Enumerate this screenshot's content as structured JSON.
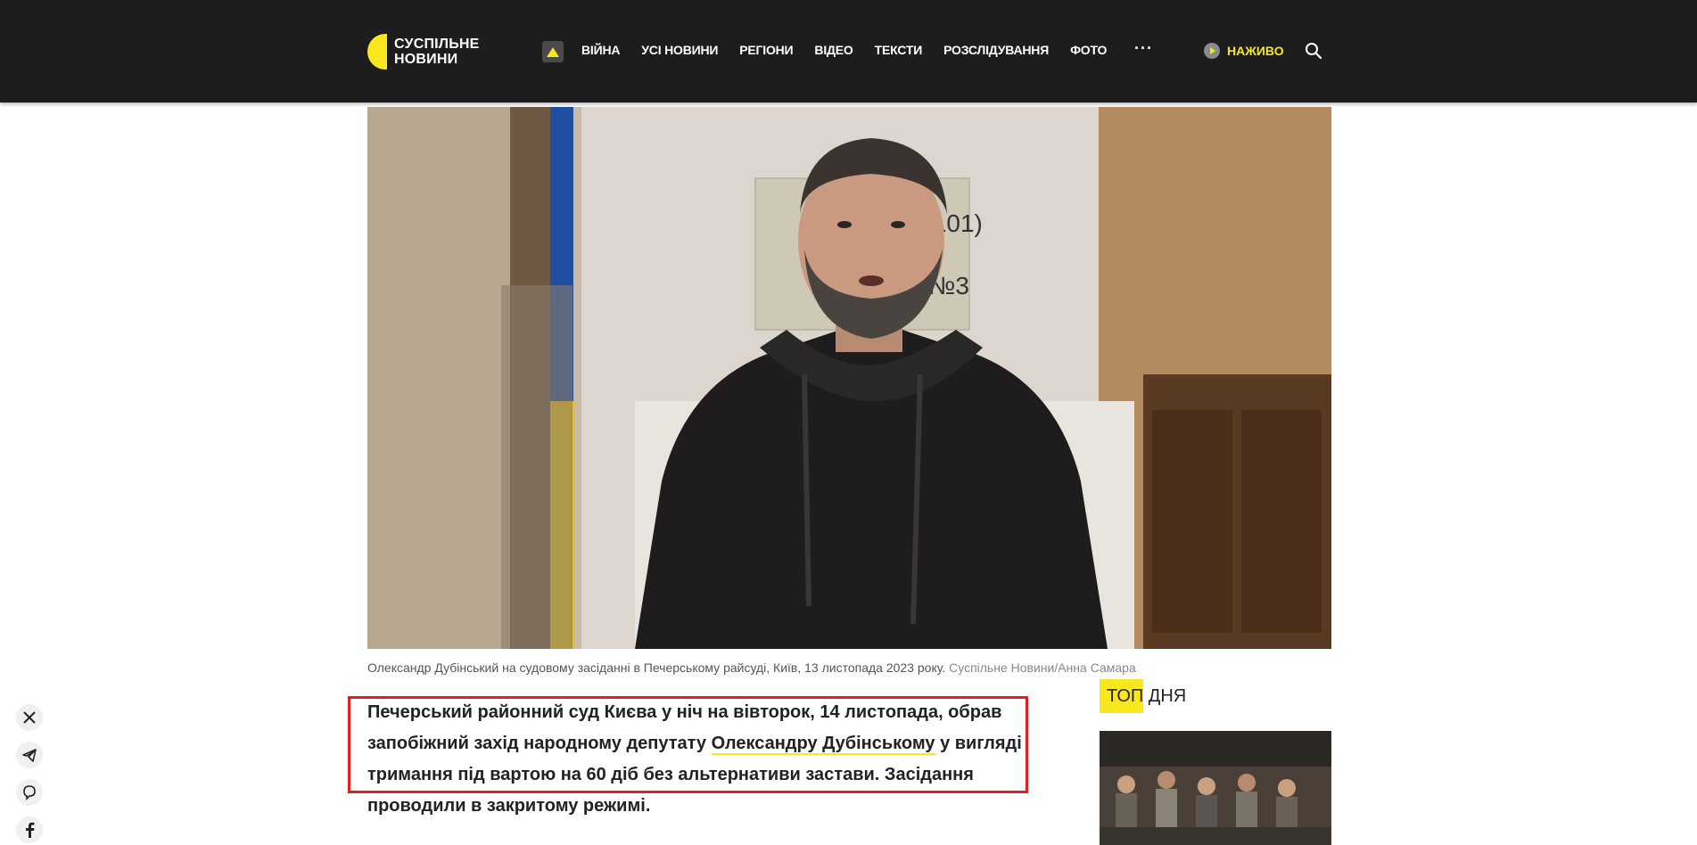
{
  "header": {
    "logo_line1": "СУСПІЛЬНЕ",
    "logo_line2": "НОВИНИ",
    "nav": [
      "ВІЙНА",
      "УСІ НОВИНИ",
      "РЕГІОНИ",
      "ВІДЕО",
      "ТЕКСТИ",
      "РОЗСЛІДУВАННЯ",
      "ФОТО"
    ],
    "more": "···",
    "live_label": "НАЖИВО"
  },
  "article": {
    "caption": "Олександр Дубінський на судовому засіданні в Печерському райсуді, Київ, 13 листопада 2023 року.",
    "caption_credit": "Суспільне Новини/Анна Самара",
    "lead_part1": "Печерський районний суд Києва у ніч на вівторок, 14 листопада, обрав запобіжний захід народному депутату ",
    "lead_link": "Олександру Дубінському",
    "lead_part2": " у вигляді тримання під вартою на 60 діб без альтернативи застави. Засідання проводили в закритому режимі."
  },
  "sidebar": {
    "top_title_hl": "ТОП",
    "top_title_rest": " ДНЯ"
  },
  "colors": {
    "accent": "#f8e71c",
    "header_bg": "#1d1d1d",
    "highlight_border": "#e02020"
  },
  "share_icons": [
    "x-icon",
    "telegram-icon",
    "viber-icon",
    "facebook-icon"
  ]
}
